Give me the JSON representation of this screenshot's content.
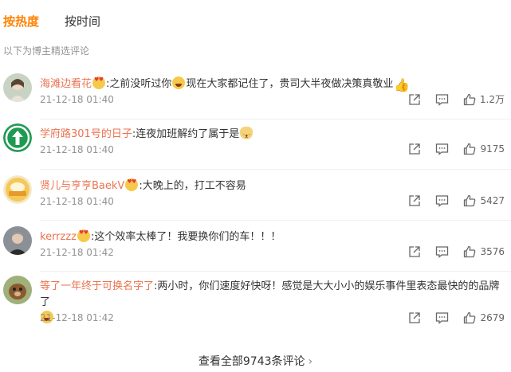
{
  "tabs": [
    {
      "label": "按热度",
      "active": true
    },
    {
      "label": "按时间",
      "active": false
    }
  ],
  "subtitle": "以下为博主精选评论",
  "comments": [
    {
      "user": "海滩边看花",
      "text_parts": [
        ":之前没听过你",
        "现在大家都记住了，贵司大半夜做决策真敬业"
      ],
      "time": "21-12-18 01:40",
      "likes": "1.2万"
    },
    {
      "user": "学府路301号的日子",
      "text_parts": [
        ":连夜加班解约了属于是"
      ],
      "time": "21-12-18 01:40",
      "likes": "9175"
    },
    {
      "user": "贤儿与亨亨BaekV",
      "text_parts": [
        ":大晚上的，打工不容易"
      ],
      "time": "21-12-18 01:40",
      "likes": "5427"
    },
    {
      "user": "kerrzzz",
      "text_parts": [
        ":这个效率太棒了！我要换你们的车！！！"
      ],
      "time": "21-12-18 01:42",
      "likes": "3576"
    },
    {
      "user": "等了一年终于可换名字了",
      "text_parts": [
        ":两小时，你们速度好快呀！感觉是大大小小的娱乐事件里表态最快的的品牌了"
      ],
      "time": "21-12-18 01:42",
      "likes": "2679"
    }
  ],
  "view_all_label": "查看全部9743条评论",
  "icons": {
    "share": "share-icon",
    "reply": "comment-icon",
    "like": "thumbs-up-icon",
    "chevron": "chevron-right-icon"
  },
  "colors": {
    "accent": "#ff8200",
    "username": "#eb7350",
    "meta": "#939393"
  }
}
